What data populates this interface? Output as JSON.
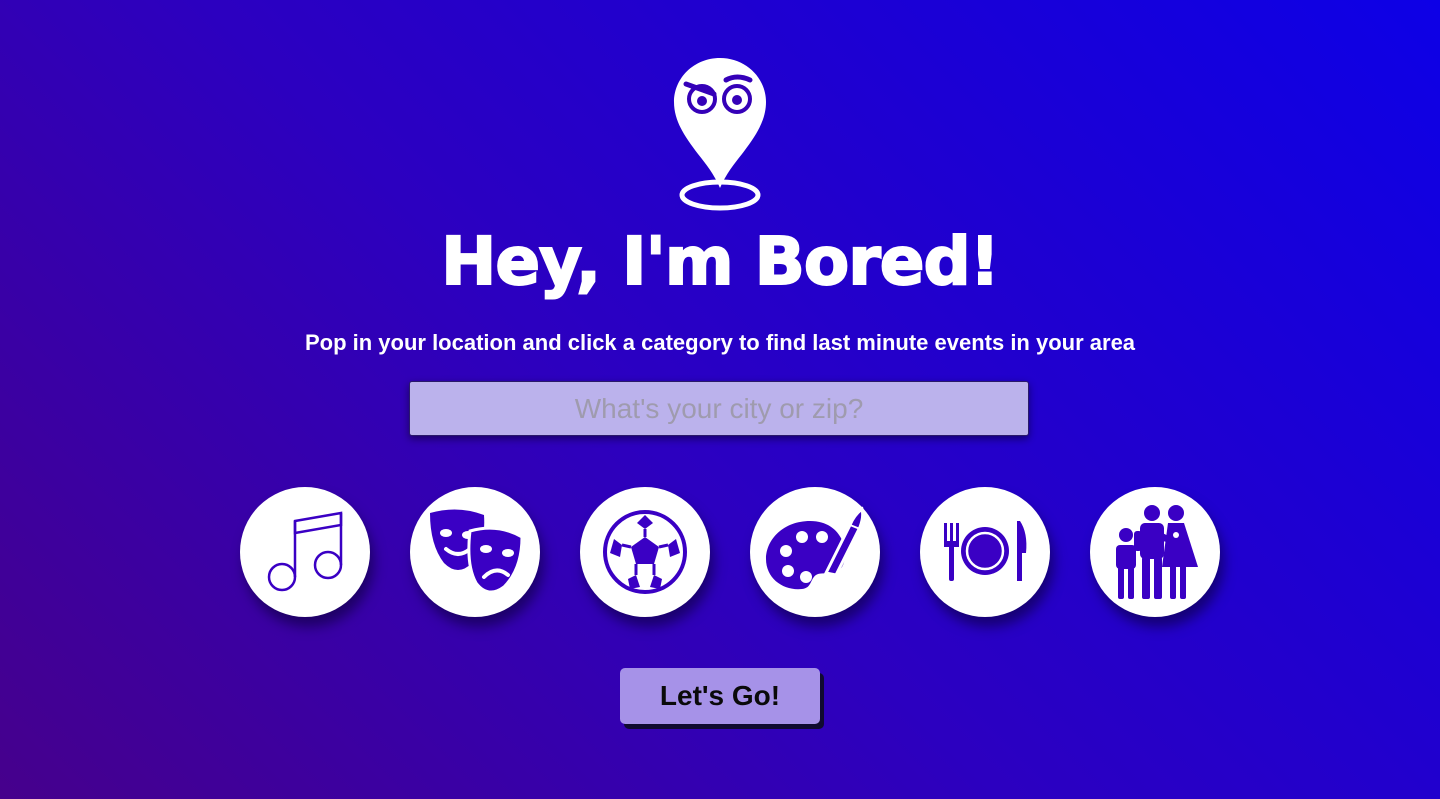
{
  "header": {
    "logo_icon": "map-pin-face-icon",
    "title": "Hey, I'm Bored!",
    "subtitle": "Pop in your location and click a category to find last minute events in your area"
  },
  "search": {
    "placeholder": "What's your city or zip?",
    "value": ""
  },
  "categories": [
    {
      "icon": "music-note-icon"
    },
    {
      "icon": "theater-masks-icon"
    },
    {
      "icon": "soccer-ball-icon"
    },
    {
      "icon": "art-palette-icon"
    },
    {
      "icon": "dining-icon"
    },
    {
      "icon": "family-icon"
    }
  ],
  "cta": {
    "label": "Let's Go!"
  },
  "colors": {
    "background_start": "#46008c",
    "background_end": "#0d00e6",
    "icon_color": "#3a00c4",
    "input_bg": "#bbb2ec",
    "button_bg": "#a692e8"
  }
}
